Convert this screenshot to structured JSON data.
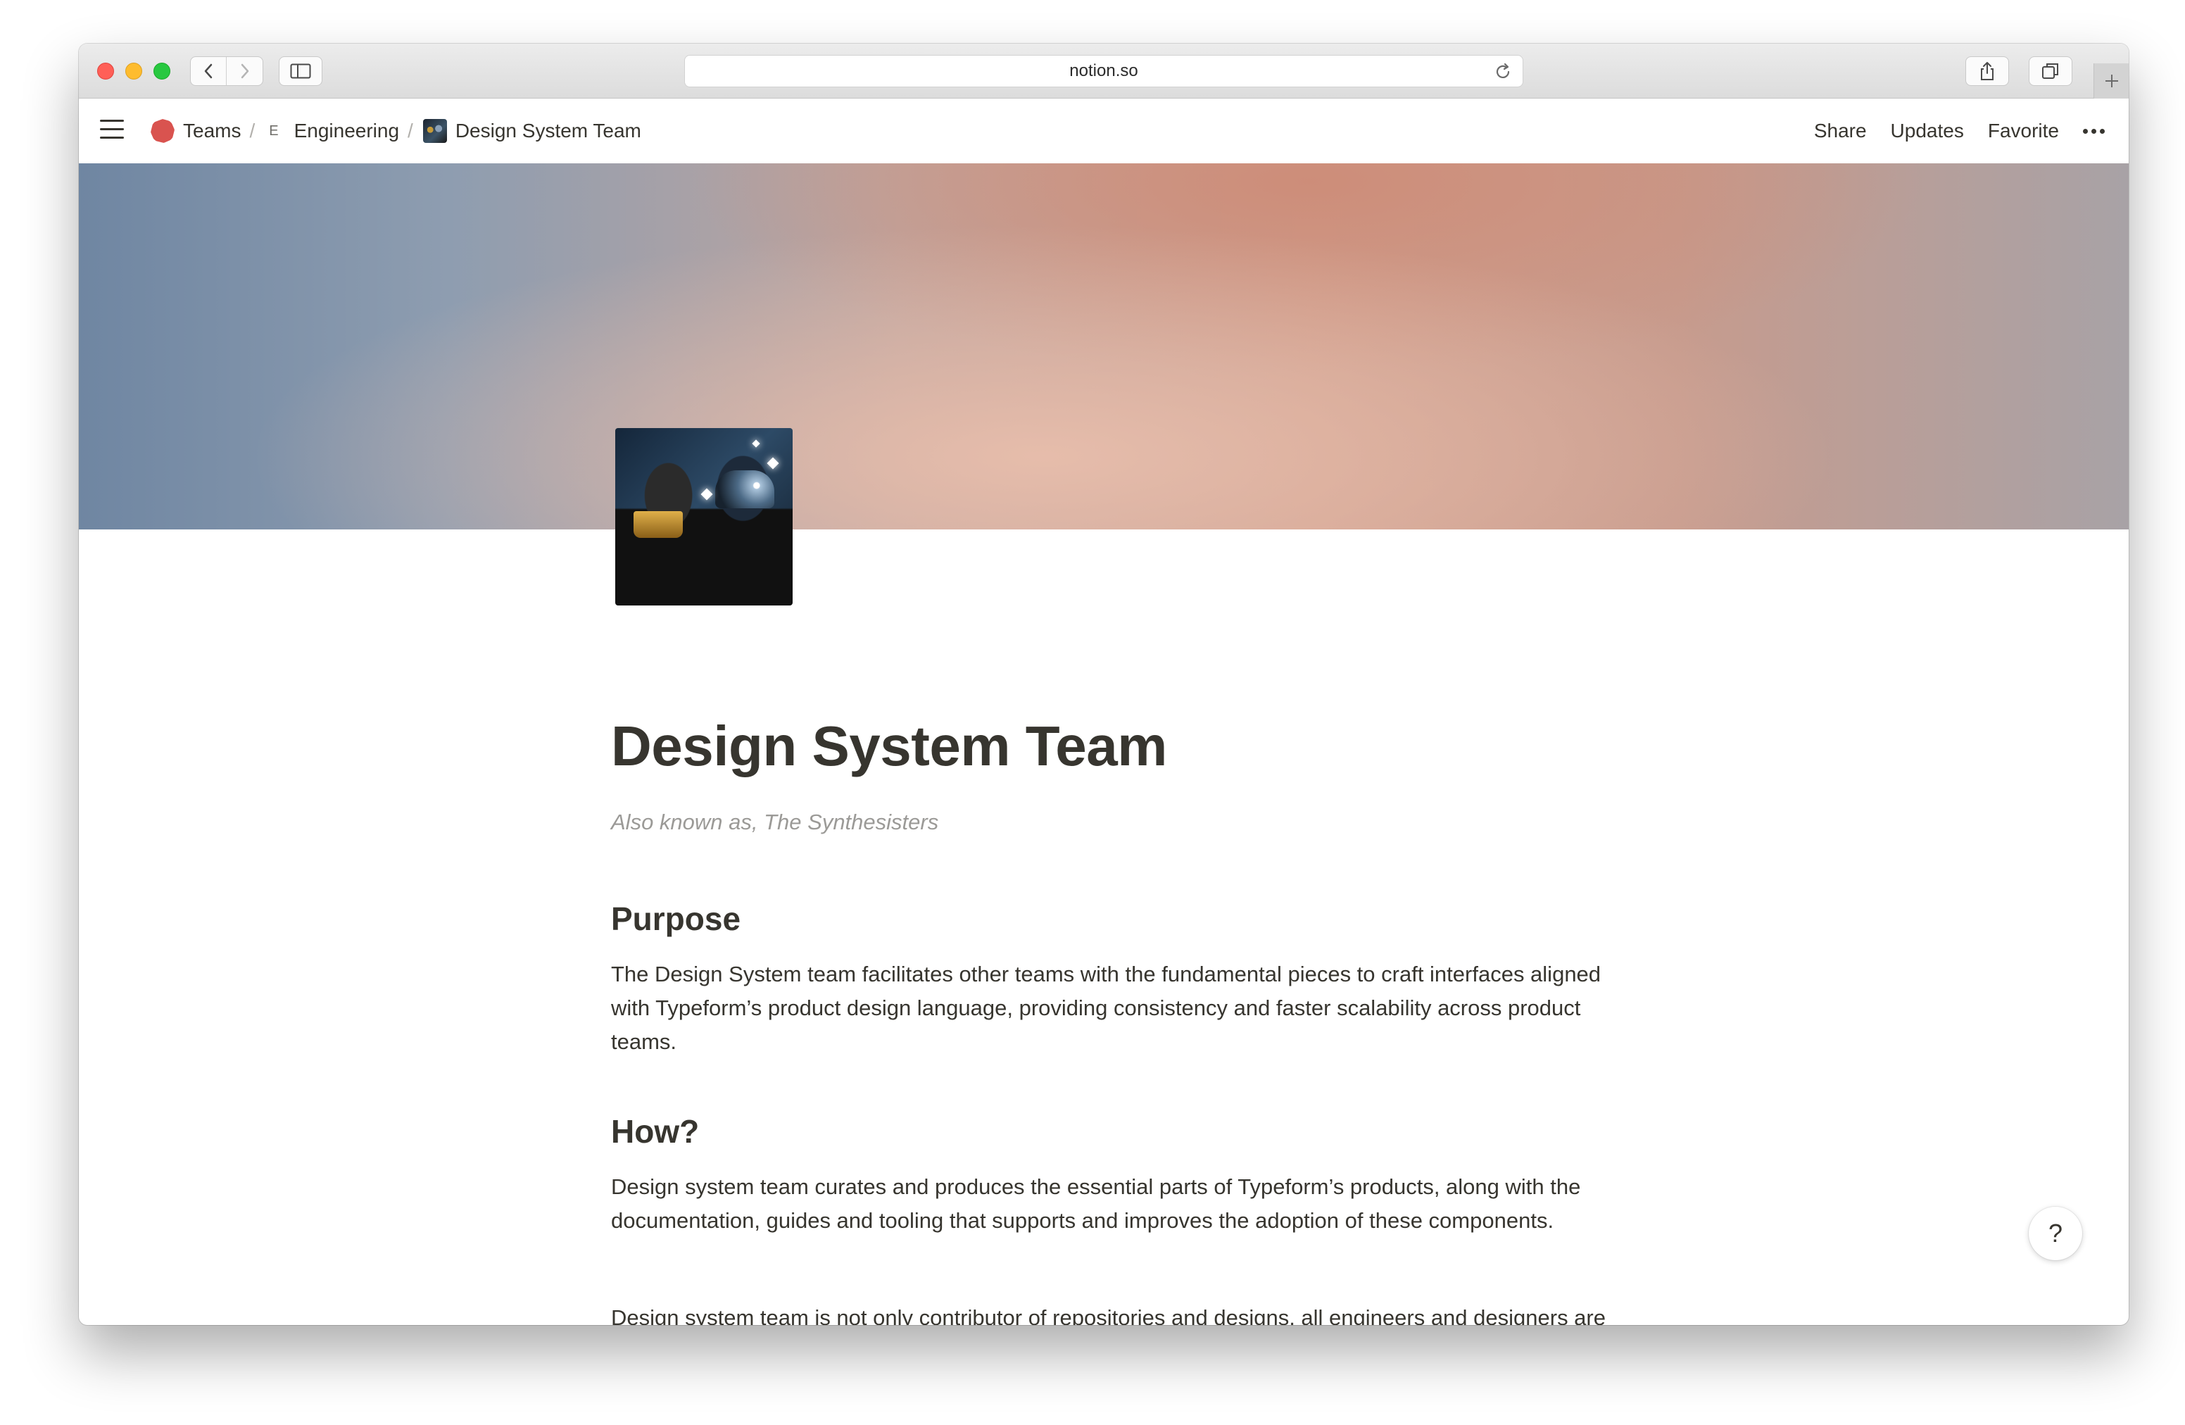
{
  "browser": {
    "address": "notion.so"
  },
  "breadcrumb": [
    {
      "label": "Teams",
      "icon": "teams-blob-icon"
    },
    {
      "label": "Engineering",
      "icon": "engineering-letter-icon",
      "icon_text": "E"
    },
    {
      "label": "Design System Team",
      "icon": "team-avatar-icon"
    }
  ],
  "breadcrumb_separator": "/",
  "topbar_actions": {
    "share": "Share",
    "updates": "Updates",
    "favorite": "Favorite"
  },
  "page": {
    "title": "Design System Team",
    "subtitle": "Also known as, The Synthesisters",
    "sections": [
      {
        "heading": "Purpose",
        "paragraphs": [
          "The Design System team facilitates other teams with the fundamental pieces to craft interfaces aligned with Typeform’s product design language, providing consistency and faster scalability across product teams."
        ]
      },
      {
        "heading": "How?",
        "paragraphs": [
          "Design system team curates and produces the essential parts of Typeform’s products, along with the documentation, guides and tooling that supports and improves the adoption of these components.",
          "Design system team is not only contributor of repositories and designs, all engineers and designers are part of the design systems evolution and growth."
        ]
      }
    ]
  },
  "help_label": "?",
  "colors": {
    "text": "#37352f",
    "muted": "#9b9a97",
    "teams_icon": "#d9534f"
  }
}
